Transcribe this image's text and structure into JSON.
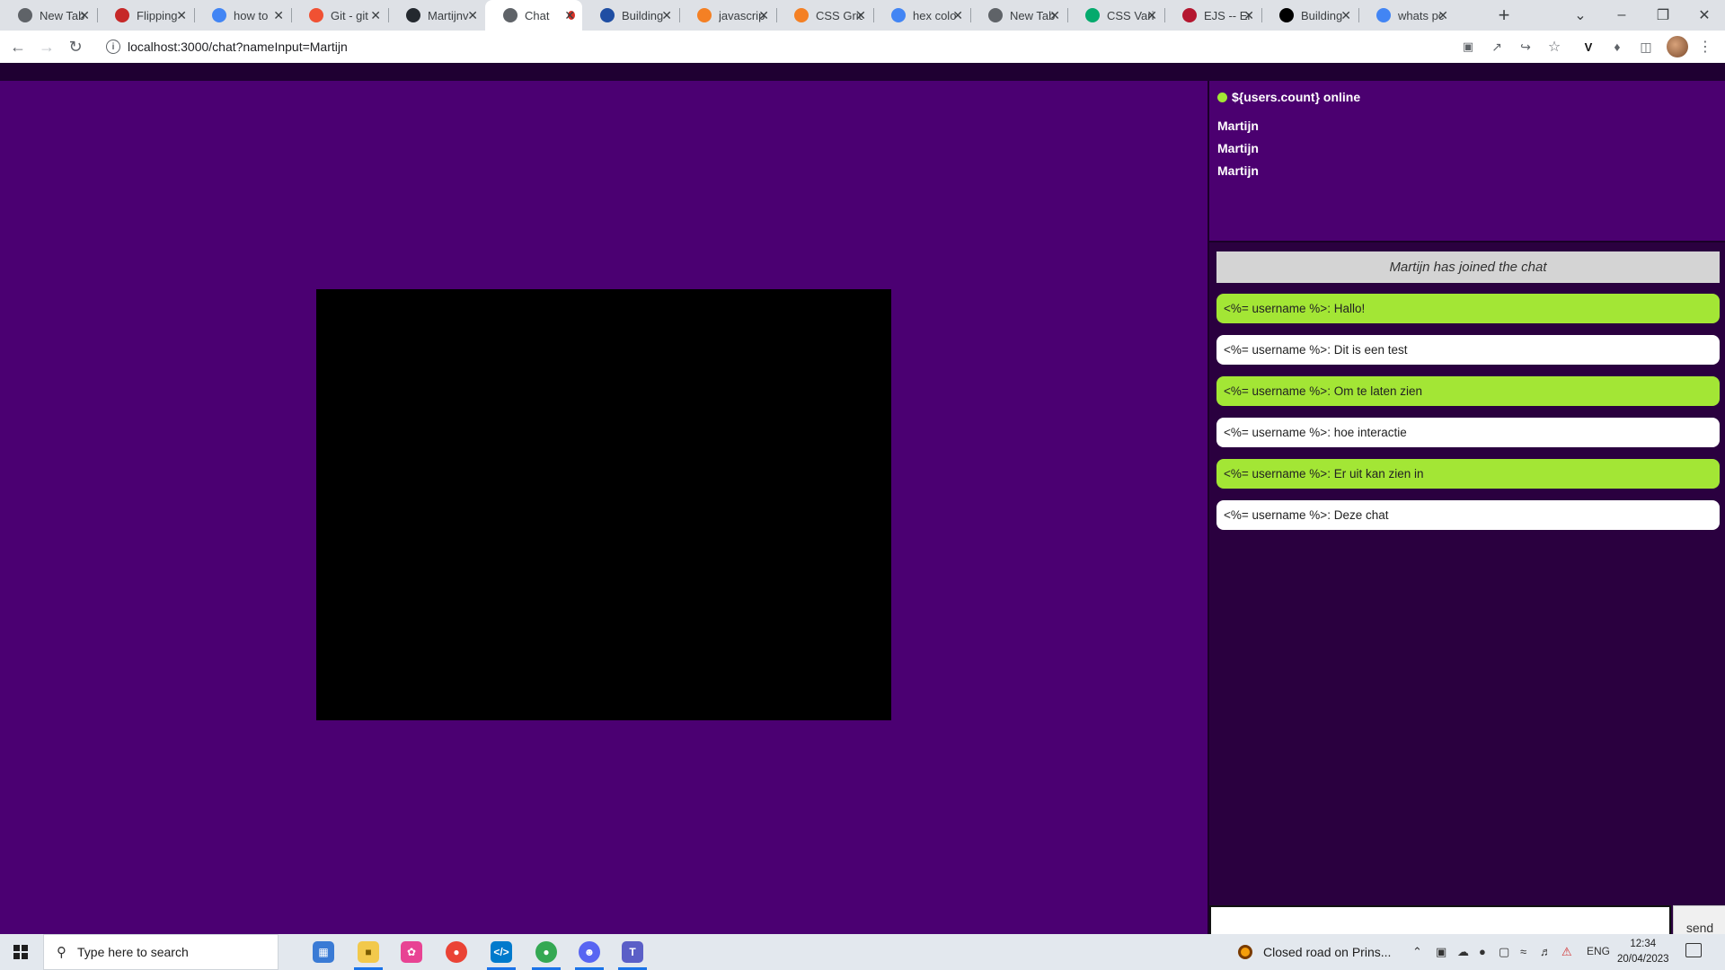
{
  "browser": {
    "tabs": [
      {
        "label": "New Tab",
        "favicon": "chrome-icon",
        "color": "#5f6368"
      },
      {
        "label": "Flipping",
        "favicon": "flip-icon",
        "color": "#c62828"
      },
      {
        "label": "how to",
        "favicon": "google-icon",
        "color": "#4285f4"
      },
      {
        "label": "Git - git",
        "favicon": "git-icon",
        "color": "#f05133"
      },
      {
        "label": "Martijnv",
        "favicon": "github-icon",
        "color": "#24292f"
      },
      {
        "label": "Chat",
        "favicon": "chrome-icon",
        "color": "#5f6368",
        "active": true
      },
      {
        "label": "Building",
        "favicon": "codesandbox-icon",
        "color": "#1f4ea3"
      },
      {
        "label": "javascrip",
        "favicon": "stackoverflow-icon",
        "color": "#f48024"
      },
      {
        "label": "CSS Grid",
        "favicon": "stackoverflow-icon",
        "color": "#f48024"
      },
      {
        "label": "hex colo",
        "favicon": "google-icon",
        "color": "#4285f4"
      },
      {
        "label": "New Tab",
        "favicon": "chrome-icon",
        "color": "#5f6368"
      },
      {
        "label": "CSS Vari",
        "favicon": "w3schools-icon",
        "color": "#04aa6d"
      },
      {
        "label": "EJS -- Er",
        "favicon": "ejs-icon",
        "color": "#b4162f"
      },
      {
        "label": "Building",
        "favicon": "medium-icon",
        "color": "#000000"
      },
      {
        "label": "whats pc",
        "favicon": "google-icon",
        "color": "#4285f4"
      }
    ],
    "url": "localhost:3000/chat?nameInput=Martijn"
  },
  "chat": {
    "online_text": "${users.count} online",
    "users": [
      "Martijn",
      "Martijn",
      "Martijn"
    ],
    "system_message": "Martijn has joined the chat",
    "messages": [
      {
        "text": "<%= username %>: Hallo!",
        "style": "green"
      },
      {
        "text": "<%= username %>: Dit is een test",
        "style": "white"
      },
      {
        "text": "<%= username %>: Om te laten zien",
        "style": "green"
      },
      {
        "text": "<%= username %>: hoe interactie",
        "style": "white"
      },
      {
        "text": "<%= username %>: Er uit kan zien in",
        "style": "green"
      },
      {
        "text": "<%= username %>: Deze chat",
        "style": "white"
      }
    ],
    "input_value": "",
    "send_label": "send"
  },
  "taskbar": {
    "search_placeholder": "Type here to search",
    "news_text": "Closed road on Prins...",
    "language": "ENG",
    "time": "12:34",
    "date": "20/04/2023"
  },
  "colors": {
    "page_bg": "#4b0072",
    "sidebar_bg": "#2a003f",
    "accent_green": "#a3e635"
  }
}
